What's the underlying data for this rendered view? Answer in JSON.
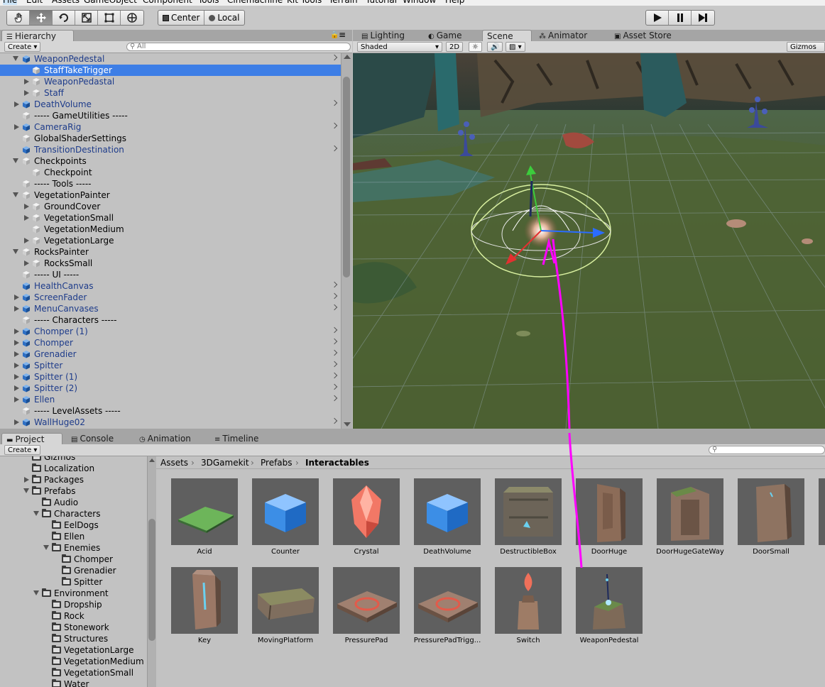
{
  "menu": [
    "File",
    "Edit",
    "Assets",
    "GameObject",
    "Component",
    "Tools",
    "Cinemachine",
    "Kit Tools",
    "Terrain",
    "Tutorial",
    "Window",
    "Help"
  ],
  "toolbar": {
    "tools": [
      "hand-tool",
      "move-tool",
      "rotate-tool",
      "scale-tool",
      "rect-tool",
      "transform-tool"
    ],
    "pivot_label": "Center",
    "space_label": "Local",
    "play": [
      "play",
      "pause",
      "step"
    ]
  },
  "hierarchy": {
    "tab_label": "Hierarchy",
    "create_label": "Create",
    "search_placeholder": "All",
    "items": [
      {
        "label": "WeaponPedestal",
        "indent": 0,
        "arrow": "down",
        "icon": "prefab",
        "chev": true,
        "style": "prefab"
      },
      {
        "label": "StaffTakeTrigger",
        "indent": 1,
        "arrow": "",
        "icon": "object",
        "chev": false,
        "style": "selected"
      },
      {
        "label": "WeaponPedastal",
        "indent": 1,
        "arrow": "right",
        "icon": "object",
        "chev": false,
        "style": "prefab"
      },
      {
        "label": "Staff",
        "indent": 1,
        "arrow": "right",
        "icon": "object",
        "chev": false,
        "style": "prefab"
      },
      {
        "label": "DeathVolume",
        "indent": 0,
        "arrow": "right",
        "icon": "prefab",
        "chev": true,
        "style": "prefab"
      },
      {
        "label": "----- GameUtilities -----",
        "indent": 0,
        "arrow": "",
        "icon": "object",
        "chev": false,
        "style": ""
      },
      {
        "label": "CameraRig",
        "indent": 0,
        "arrow": "right",
        "icon": "prefab",
        "chev": true,
        "style": "prefab"
      },
      {
        "label": "GlobalShaderSettings",
        "indent": 0,
        "arrow": "",
        "icon": "object",
        "chev": false,
        "style": ""
      },
      {
        "label": "TransitionDestination",
        "indent": 0,
        "arrow": "",
        "icon": "prefab",
        "chev": true,
        "style": "prefab"
      },
      {
        "label": "Checkpoints",
        "indent": 0,
        "arrow": "down",
        "icon": "object",
        "chev": false,
        "style": ""
      },
      {
        "label": "Checkpoint",
        "indent": 1,
        "arrow": "",
        "icon": "object",
        "chev": false,
        "style": ""
      },
      {
        "label": "----- Tools -----",
        "indent": 0,
        "arrow": "",
        "icon": "object",
        "chev": false,
        "style": ""
      },
      {
        "label": "VegetationPainter",
        "indent": 0,
        "arrow": "down",
        "icon": "object",
        "chev": false,
        "style": ""
      },
      {
        "label": "GroundCover",
        "indent": 1,
        "arrow": "right",
        "icon": "object",
        "chev": false,
        "style": ""
      },
      {
        "label": "VegetationSmall",
        "indent": 1,
        "arrow": "right",
        "icon": "object",
        "chev": false,
        "style": ""
      },
      {
        "label": "VegetationMedium",
        "indent": 1,
        "arrow": "",
        "icon": "object",
        "chev": false,
        "style": ""
      },
      {
        "label": "VegetationLarge",
        "indent": 1,
        "arrow": "right",
        "icon": "object",
        "chev": false,
        "style": ""
      },
      {
        "label": "RocksPainter",
        "indent": 0,
        "arrow": "down",
        "icon": "object",
        "chev": false,
        "style": ""
      },
      {
        "label": "RocksSmall",
        "indent": 1,
        "arrow": "right",
        "icon": "object",
        "chev": false,
        "style": ""
      },
      {
        "label": "----- UI -----",
        "indent": 0,
        "arrow": "",
        "icon": "object",
        "chev": false,
        "style": ""
      },
      {
        "label": "HealthCanvas",
        "indent": 0,
        "arrow": "",
        "icon": "prefab",
        "chev": true,
        "style": "prefab"
      },
      {
        "label": "ScreenFader",
        "indent": 0,
        "arrow": "right",
        "icon": "prefab",
        "chev": true,
        "style": "prefab"
      },
      {
        "label": "MenuCanvases",
        "indent": 0,
        "arrow": "right",
        "icon": "prefab",
        "chev": true,
        "style": "prefab"
      },
      {
        "label": "----- Characters -----",
        "indent": 0,
        "arrow": "",
        "icon": "object",
        "chev": false,
        "style": ""
      },
      {
        "label": "Chomper (1)",
        "indent": 0,
        "arrow": "right",
        "icon": "prefab",
        "chev": true,
        "style": "prefab"
      },
      {
        "label": "Chomper",
        "indent": 0,
        "arrow": "right",
        "icon": "prefab",
        "chev": true,
        "style": "prefab"
      },
      {
        "label": "Grenadier",
        "indent": 0,
        "arrow": "right",
        "icon": "prefab",
        "chev": true,
        "style": "prefab"
      },
      {
        "label": "Spitter",
        "indent": 0,
        "arrow": "right",
        "icon": "prefab",
        "chev": true,
        "style": "prefab"
      },
      {
        "label": "Spitter (1)",
        "indent": 0,
        "arrow": "right",
        "icon": "prefab",
        "chev": true,
        "style": "prefab"
      },
      {
        "label": "Spitter (2)",
        "indent": 0,
        "arrow": "right",
        "icon": "prefab",
        "chev": true,
        "style": "prefab"
      },
      {
        "label": "Ellen",
        "indent": 0,
        "arrow": "right",
        "icon": "prefab",
        "chev": true,
        "style": "prefab"
      },
      {
        "label": "----- LevelAssets -----",
        "indent": 0,
        "arrow": "",
        "icon": "object",
        "chev": false,
        "style": ""
      },
      {
        "label": "WallHuge02",
        "indent": 0,
        "arrow": "right",
        "icon": "prefab",
        "chev": true,
        "style": "prefab"
      }
    ]
  },
  "scene_tabs": [
    {
      "label": "Lighting",
      "icon": "lighting-icon"
    },
    {
      "label": "Game",
      "icon": "game-icon"
    },
    {
      "label": "Scene",
      "icon": ""
    },
    {
      "label": "Animator",
      "icon": "animator-icon"
    },
    {
      "label": "Asset Store",
      "icon": "store-icon"
    }
  ],
  "scene_toolbar": {
    "draw_mode": "Shaded",
    "mode_2d": "2D",
    "gizmos_label": "Gizmos"
  },
  "bottom_tabs": [
    {
      "label": "Project",
      "icon": "folder-icon"
    },
    {
      "label": "Console",
      "icon": "console-icon"
    },
    {
      "label": "Animation",
      "icon": "animation-icon"
    },
    {
      "label": "Timeline",
      "icon": "timeline-icon"
    }
  ],
  "project": {
    "create_label": "Create",
    "tree": [
      {
        "label": "Gizmos",
        "indent": 2,
        "arrow": ""
      },
      {
        "label": "Localization",
        "indent": 2,
        "arrow": ""
      },
      {
        "label": "Packages",
        "indent": 2,
        "arrow": "right"
      },
      {
        "label": "Prefabs",
        "indent": 2,
        "arrow": "down"
      },
      {
        "label": "Audio",
        "indent": 3,
        "arrow": ""
      },
      {
        "label": "Characters",
        "indent": 3,
        "arrow": "down"
      },
      {
        "label": "EelDogs",
        "indent": 4,
        "arrow": ""
      },
      {
        "label": "Ellen",
        "indent": 4,
        "arrow": ""
      },
      {
        "label": "Enemies",
        "indent": 4,
        "arrow": "down"
      },
      {
        "label": "Chomper",
        "indent": 5,
        "arrow": ""
      },
      {
        "label": "Grenadier",
        "indent": 5,
        "arrow": ""
      },
      {
        "label": "Spitter",
        "indent": 5,
        "arrow": ""
      },
      {
        "label": "Environment",
        "indent": 3,
        "arrow": "down"
      },
      {
        "label": "Dropship",
        "indent": 4,
        "arrow": ""
      },
      {
        "label": "Rock",
        "indent": 4,
        "arrow": ""
      },
      {
        "label": "Stonework",
        "indent": 4,
        "arrow": ""
      },
      {
        "label": "Structures",
        "indent": 4,
        "arrow": ""
      },
      {
        "label": "VegetationLarge",
        "indent": 4,
        "arrow": ""
      },
      {
        "label": "VegetationMedium",
        "indent": 4,
        "arrow": ""
      },
      {
        "label": "VegetationSmall",
        "indent": 4,
        "arrow": ""
      },
      {
        "label": "Water",
        "indent": 4,
        "arrow": ""
      }
    ],
    "breadcrumb": [
      "Assets",
      "3DGamekit",
      "Prefabs",
      "Interactables"
    ],
    "assets": [
      {
        "label": "Acid",
        "kind": "acid"
      },
      {
        "label": "Counter",
        "kind": "cube"
      },
      {
        "label": "Crystal",
        "kind": "crystal"
      },
      {
        "label": "DeathVolume",
        "kind": "cube"
      },
      {
        "label": "DestructibleBox",
        "kind": "box"
      },
      {
        "label": "DoorHuge",
        "kind": "door"
      },
      {
        "label": "DoorHugeGateWay",
        "kind": "gateway"
      },
      {
        "label": "DoorSmall",
        "kind": "doorsmall"
      },
      {
        "label": "Key",
        "kind": "key"
      },
      {
        "label": "MovingPlatform",
        "kind": "platform"
      },
      {
        "label": "PressurePad",
        "kind": "pad"
      },
      {
        "label": "PressurePadTrigg...",
        "kind": "pad"
      },
      {
        "label": "Switch",
        "kind": "switch"
      },
      {
        "label": "WeaponPedestal",
        "kind": "pedestal"
      }
    ]
  },
  "colors": {
    "selection": "#3d7ee6",
    "prefab_text": "#1d3b8a",
    "drag_arrow": "#ff00ff"
  }
}
